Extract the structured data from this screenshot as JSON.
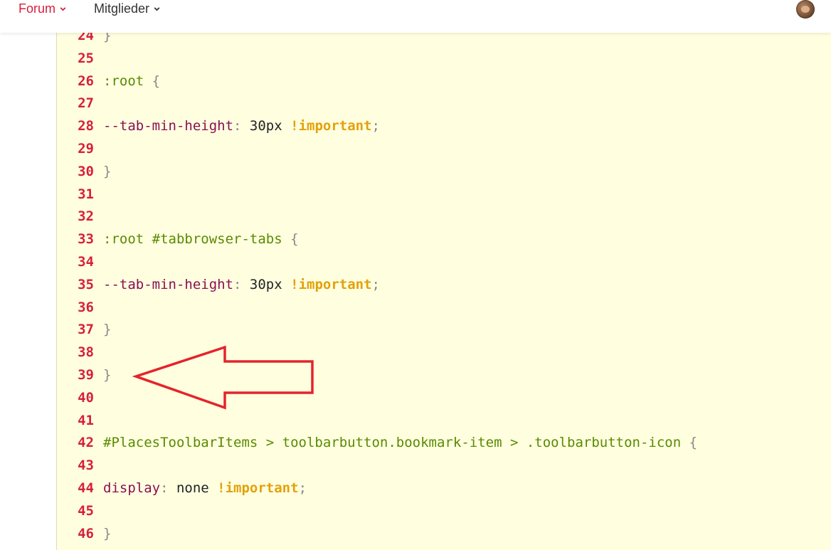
{
  "nav": {
    "items": [
      {
        "label": "Forum",
        "color": "#d61f3c",
        "icon": "chevron-down-icon"
      },
      {
        "label": "Mitglieder",
        "color": "#333333",
        "icon": "chevron-down-icon"
      }
    ],
    "avatar_icon": "user-avatar"
  },
  "colors": {
    "accent": "#d61f3c",
    "code_background": "#ffffe0",
    "selector": "#5a8a00",
    "property": "#8a0f52",
    "important": "#e3a10a",
    "punctuation": "#888888",
    "arrow": "#e5232b"
  },
  "code": {
    "lines": [
      {
        "n": "24",
        "tokens": [
          {
            "t": "}",
            "c": "punct"
          }
        ]
      },
      {
        "n": "25",
        "tokens": []
      },
      {
        "n": "26",
        "tokens": [
          {
            "t": ":root",
            "c": "sel"
          },
          {
            "t": " ",
            "c": "val"
          },
          {
            "t": "{",
            "c": "punct"
          }
        ]
      },
      {
        "n": "27",
        "tokens": []
      },
      {
        "n": "28",
        "tokens": [
          {
            "t": "--tab-min-height",
            "c": "prop"
          },
          {
            "t": ":",
            "c": "punct"
          },
          {
            "t": " 30px ",
            "c": "val"
          },
          {
            "t": "!important",
            "c": "imp"
          },
          {
            "t": ";",
            "c": "punct"
          }
        ]
      },
      {
        "n": "29",
        "tokens": []
      },
      {
        "n": "30",
        "tokens": [
          {
            "t": "}",
            "c": "punct"
          }
        ]
      },
      {
        "n": "31",
        "tokens": []
      },
      {
        "n": "32",
        "tokens": []
      },
      {
        "n": "33",
        "tokens": [
          {
            "t": ":root #tabbrowser-tabs",
            "c": "sel"
          },
          {
            "t": " ",
            "c": "val"
          },
          {
            "t": "{",
            "c": "punct"
          }
        ]
      },
      {
        "n": "34",
        "tokens": []
      },
      {
        "n": "35",
        "tokens": [
          {
            "t": "--tab-min-height",
            "c": "prop"
          },
          {
            "t": ":",
            "c": "punct"
          },
          {
            "t": " 30px ",
            "c": "val"
          },
          {
            "t": "!important",
            "c": "imp"
          },
          {
            "t": ";",
            "c": "punct"
          }
        ]
      },
      {
        "n": "36",
        "tokens": []
      },
      {
        "n": "37",
        "tokens": [
          {
            "t": "}",
            "c": "punct"
          }
        ]
      },
      {
        "n": "38",
        "tokens": []
      },
      {
        "n": "39",
        "tokens": [
          {
            "t": "}",
            "c": "punct"
          }
        ]
      },
      {
        "n": "40",
        "tokens": []
      },
      {
        "n": "41",
        "tokens": []
      },
      {
        "n": "42",
        "tokens": [
          {
            "t": "#PlacesToolbarItems > toolbarbutton.bookmark-item > .toolbarbutton-icon",
            "c": "sel"
          },
          {
            "t": " ",
            "c": "val"
          },
          {
            "t": "{",
            "c": "punct"
          }
        ]
      },
      {
        "n": "43",
        "tokens": []
      },
      {
        "n": "44",
        "tokens": [
          {
            "t": "display",
            "c": "prop"
          },
          {
            "t": ":",
            "c": "punct"
          },
          {
            "t": " none ",
            "c": "val"
          },
          {
            "t": "!important",
            "c": "imp"
          },
          {
            "t": ";",
            "c": "punct"
          }
        ]
      },
      {
        "n": "45",
        "tokens": []
      },
      {
        "n": "46",
        "tokens": [
          {
            "t": "}",
            "c": "punct"
          }
        ]
      }
    ]
  },
  "annotation": {
    "type": "arrow",
    "direction": "left",
    "points_to_line": "39"
  }
}
